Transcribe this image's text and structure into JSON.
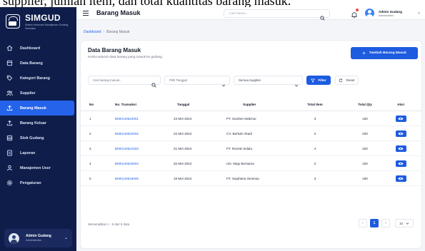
{
  "top_overlay_text": "supplier, jumlah item, dan total kuantitas barang masuk.",
  "sidebar": {
    "app_name": "SIMGUD",
    "app_subtitle": "Sistem Informasi Manajemen Gudang Sembako",
    "items": [
      {
        "label": "Dashboard",
        "icon": "home-icon"
      },
      {
        "label": "Data Barang",
        "icon": "box-icon"
      },
      {
        "label": "Kategori Barang",
        "icon": "tag-icon"
      },
      {
        "label": "Supplier",
        "icon": "users-icon"
      },
      {
        "label": "Barang Masuk",
        "icon": "upload-icon",
        "active": true
      },
      {
        "label": "Barang Keluar",
        "icon": "upload-icon"
      },
      {
        "label": "Stok Gudang",
        "icon": "warehouse-icon"
      },
      {
        "label": "Laporan",
        "icon": "report-icon"
      },
      {
        "label": "Manajemen User",
        "icon": "user-icon"
      },
      {
        "label": "Pengaturan",
        "icon": "gear-icon"
      }
    ],
    "user": {
      "name": "Admin Gudang",
      "role": "Administrator"
    }
  },
  "header": {
    "title": "Barang Masuk",
    "search_placeholder": "Cari menu...",
    "user": {
      "name": "Admin Gudang",
      "role": "Administrator"
    }
  },
  "breadcrumb": {
    "home": "Dashboard",
    "current": "Barang Masuk"
  },
  "main": {
    "title": "Data Barang Masuk",
    "subtitle": "Kelola seluruh data barang yang masuk ke gudang.",
    "add_button": "Tambah Barang Masuk",
    "filters": {
      "search_placeholder": "Cari barang masuk...",
      "date_placeholder": "Pilih Tanggal",
      "supplier_selected": "Semua Supplier",
      "filter_button": "Filter",
      "reset_button": "Reset"
    },
    "table": {
      "headers": [
        "No",
        "No. Transaksi",
        "Tanggal",
        "Supplier",
        "Total Item",
        "Total Qty",
        "Aksi"
      ],
      "rows": [
        {
          "no": "1",
          "trx": "BMK240523001",
          "tanggal": "23 Mei 2024",
          "supplier": "PT. Sumber Makmur",
          "item": "3",
          "qty": "150"
        },
        {
          "no": "2",
          "trx": "BMK240522002",
          "tanggal": "22 Mei 2024",
          "supplier": "CV. Berkah Abadi",
          "item": "2",
          "qty": "200"
        },
        {
          "no": "3",
          "trx": "BMK240521003",
          "tanggal": "21 Mei 2024",
          "supplier": "PT. Rezeki Selalu",
          "item": "4",
          "qty": "320"
        },
        {
          "no": "4",
          "trx": "BMK240520004",
          "tanggal": "20 Mei 2024",
          "supplier": "UD. Maju Bersama",
          "item": "2",
          "qty": "100"
        },
        {
          "no": "5",
          "trx": "BMK240519005",
          "tanggal": "19 Mei 2024",
          "supplier": "PT. Sejahtera Sentosa",
          "item": "3",
          "qty": "180"
        }
      ]
    },
    "info": "Menampilkan 1 - 5 dari 5 data",
    "pagination": {
      "prev": "‹",
      "current": "1",
      "next": "›",
      "per_page": "10"
    }
  },
  "colors": {
    "sidebar_bg": "#0f1d4a",
    "accent": "#1d5be0",
    "link": "#2563eb"
  }
}
